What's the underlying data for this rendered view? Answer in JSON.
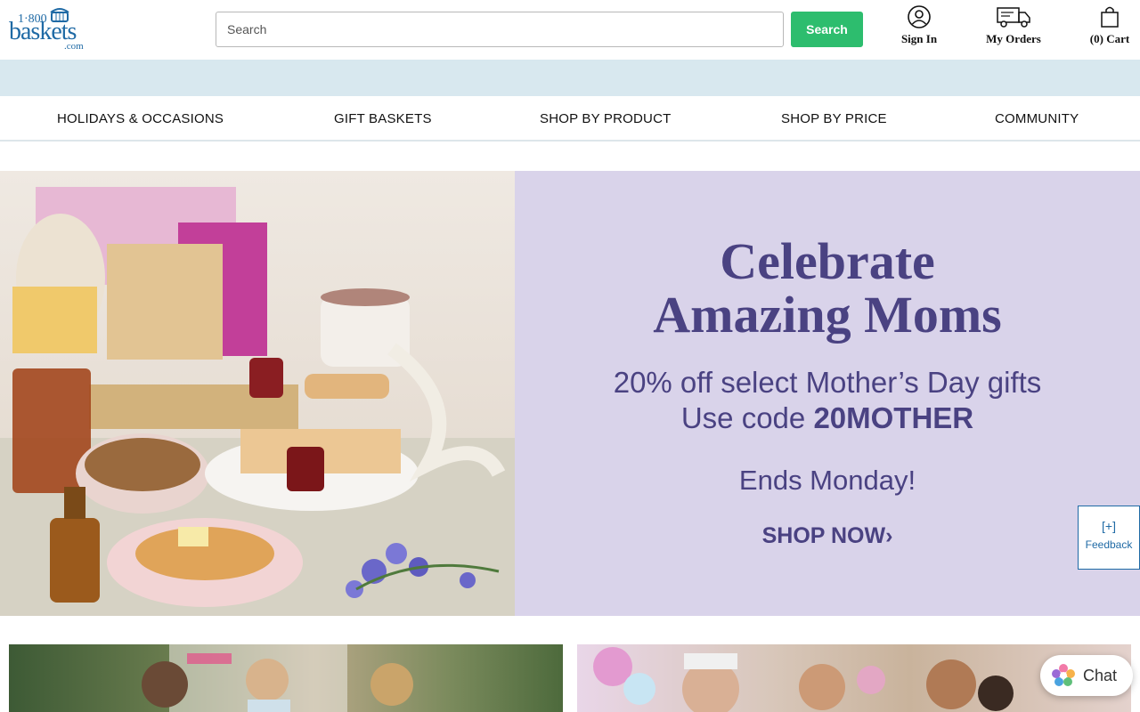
{
  "logo": {
    "line1": "1·800",
    "line2": "baskets",
    "line3": ".com"
  },
  "search": {
    "placeholder": "Search",
    "button_label": "Search"
  },
  "header_links": {
    "sign_in": "Sign In",
    "my_orders": "My Orders",
    "cart": "(0) Cart"
  },
  "nav": {
    "items": [
      {
        "label": "HOLIDAYS & OCCASIONS"
      },
      {
        "label": "GIFT BASKETS"
      },
      {
        "label": "SHOP BY PRODUCT"
      },
      {
        "label": "SHOP BY PRICE"
      },
      {
        "label": "COMMUNITY"
      }
    ]
  },
  "hero": {
    "title_line1": "Celebrate",
    "title_line2": "Amazing Moms",
    "sub_line1": "20% off select Mother’s Day gifts",
    "sub_line2_prefix": "Use code ",
    "promo_code": "20MOTHER",
    "ends": "Ends Monday!",
    "cta": "SHOP NOW",
    "cta_chevron": "›"
  },
  "feedback": {
    "plus": "[+]",
    "label": "Feedback"
  },
  "chat": {
    "label": "Chat"
  },
  "colors": {
    "brand_blue": "#1f6aa5",
    "search_green": "#2dbd6e",
    "promo_bar": "#d8e8ef",
    "hero_panel": "#d9d3ea",
    "hero_text": "#4a4282"
  },
  "icons": [
    "user-circle-icon",
    "delivery-truck-icon",
    "shopping-bag-icon",
    "chat-flower-icon"
  ]
}
